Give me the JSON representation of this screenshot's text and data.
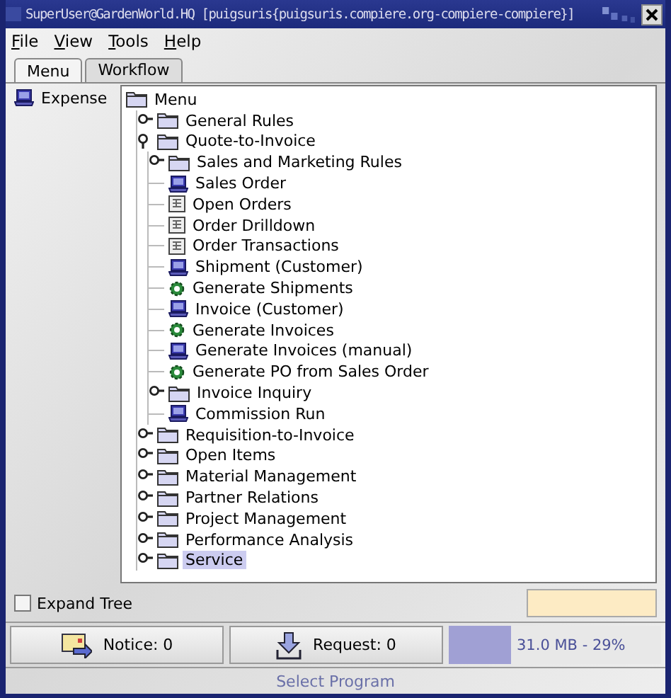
{
  "window": {
    "title": "SuperUser@GardenWorld.HQ [puigsuris{puigsuris.compiere.org-compiere-compiere}]"
  },
  "menu_bar": [
    "File",
    "View",
    "Tools",
    "Help"
  ],
  "tabs": [
    {
      "label": "Menu",
      "selected": true
    },
    {
      "label": "Workflow",
      "selected": false
    }
  ],
  "shortcuts": [
    {
      "label": "Expense",
      "kind": "window"
    }
  ],
  "tree": {
    "root": {
      "label": "Menu",
      "selected": false,
      "children": [
        {
          "label": "General Rules",
          "kind": "folder",
          "expanded": false,
          "selected": false
        },
        {
          "label": "Quote-to-Invoice",
          "kind": "folder",
          "expanded": true,
          "selected": false,
          "children": [
            {
              "label": "Sales and Marketing Rules",
              "kind": "folder",
              "expanded": false,
              "selected": false
            },
            {
              "label": "Sales Order",
              "kind": "window",
              "selected": false
            },
            {
              "label": "Open Orders",
              "kind": "report",
              "selected": false
            },
            {
              "label": "Order Drilldown",
              "kind": "report",
              "selected": false
            },
            {
              "label": "Order Transactions",
              "kind": "report",
              "selected": false
            },
            {
              "label": "Shipment (Customer)",
              "kind": "window",
              "selected": false
            },
            {
              "label": "Generate Shipments",
              "kind": "process",
              "selected": false
            },
            {
              "label": "Invoice (Customer)",
              "kind": "window",
              "selected": false
            },
            {
              "label": "Generate Invoices",
              "kind": "process",
              "selected": false
            },
            {
              "label": "Generate Invoices (manual)",
              "kind": "window",
              "selected": false
            },
            {
              "label": "Generate PO from Sales Order",
              "kind": "process",
              "selected": false
            },
            {
              "label": "Invoice Inquiry",
              "kind": "folder",
              "expanded": false,
              "selected": false
            },
            {
              "label": "Commission Run",
              "kind": "window",
              "selected": false
            }
          ]
        },
        {
          "label": "Requisition-to-Invoice",
          "kind": "folder",
          "expanded": false,
          "selected": false
        },
        {
          "label": "Open Items",
          "kind": "folder",
          "expanded": false,
          "selected": false
        },
        {
          "label": "Material Management",
          "kind": "folder",
          "expanded": false,
          "selected": false
        },
        {
          "label": "Partner Relations",
          "kind": "folder",
          "expanded": false,
          "selected": false
        },
        {
          "label": "Project Management",
          "kind": "folder",
          "expanded": false,
          "selected": false
        },
        {
          "label": "Performance Analysis",
          "kind": "folder",
          "expanded": false,
          "selected": false
        },
        {
          "label": "Service",
          "kind": "folder",
          "expanded": false,
          "selected": true
        }
      ]
    }
  },
  "expand_tree": {
    "label": "Expand Tree",
    "checked": false
  },
  "buttons": [
    {
      "label": "Notice: 0",
      "kind": "notice"
    },
    {
      "label": "Request: 0",
      "kind": "request"
    }
  ],
  "memory": {
    "reading": "31.0 MB - 29%",
    "level": 0.29
  },
  "status_bar": "Select Program"
}
